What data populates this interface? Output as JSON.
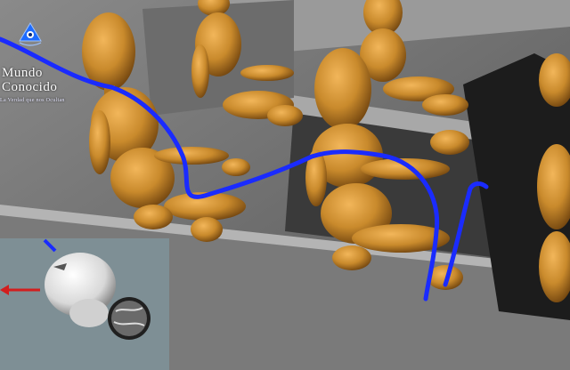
{
  "logo": {
    "title_line1": "Mundo",
    "title_line2": "Conocido",
    "tagline": "La Verdad que nos Ocultan",
    "eye_icon": "pyramid-eye-icon",
    "accent": "#1e6bff"
  },
  "scene": {
    "background": "#5a5a5a",
    "figure_color": "#c88a2a",
    "figure_shadow": "#7a4a10",
    "pathway_color": "#1a2bff"
  },
  "inset": {
    "background": "#8fa0a6",
    "arrow_color": "#d21e1e"
  }
}
